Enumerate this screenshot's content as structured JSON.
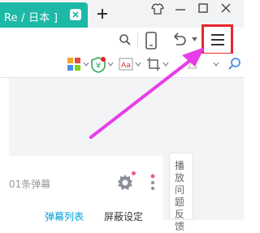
{
  "tab": {
    "title": "Re  / 日本 ]"
  },
  "toolbar": {
    "icons": [
      "search-icon",
      "mobile-icon",
      "undo-icon",
      "menu-icon"
    ]
  },
  "extensions": [
    "extension-grid-icon",
    "yuan-shield-icon",
    "translate-icon",
    "screenshot-icon",
    "search-icon"
  ],
  "page": {
    "danmaku_count": "01条弹幕",
    "tab_danmaku_list": "弹幕列表",
    "tab_block_settings": "屏蔽设定",
    "feedback": "播放问题反馈"
  },
  "colors": {
    "tab": "#1bb9a6",
    "highlight": "#e8262d",
    "arrow": "#e83ce8",
    "link": "#00a1d6",
    "dot": "#f25d8e"
  }
}
